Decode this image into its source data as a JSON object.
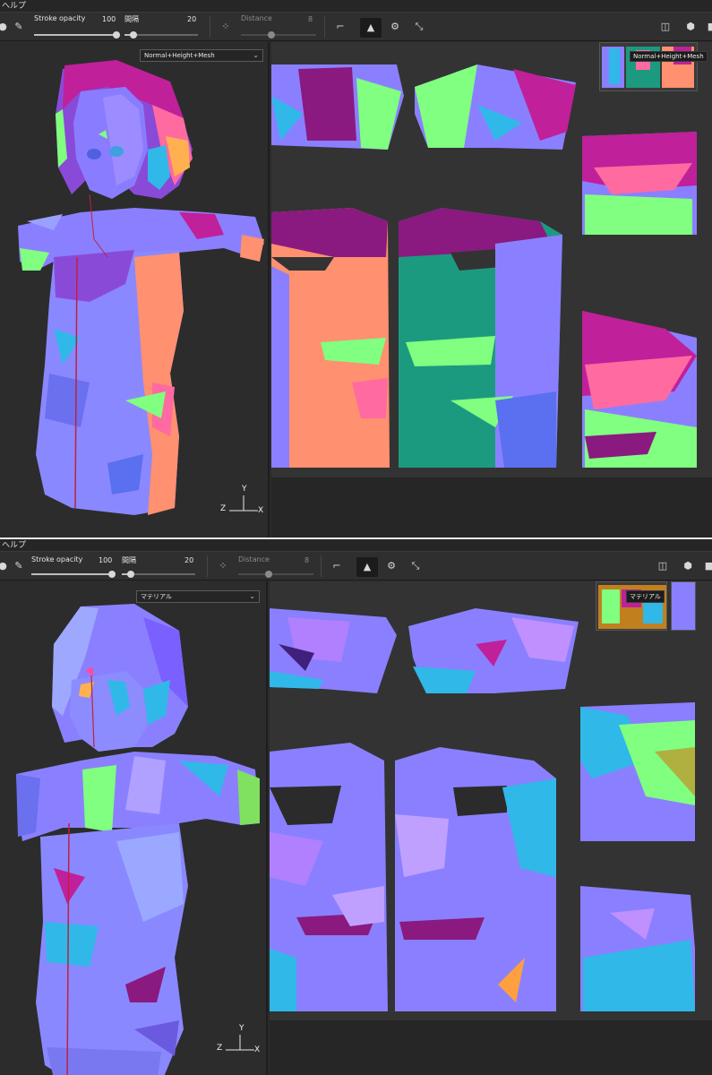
{
  "panels": [
    {
      "menu_label": "ヘルプ",
      "stroke_opacity_label": "Stroke opacity",
      "stroke_opacity_value": "100",
      "spacing_label": "間隔",
      "spacing_value": "20",
      "distance_label": "Distance",
      "distance_value": "8",
      "display_mode": "Normal+Height+Mesh",
      "tooltip": "Normal+Height+Mesh",
      "axis_z": "Z",
      "axis_y": "Y",
      "axis_x": "X"
    },
    {
      "menu_label": "ヘルプ",
      "stroke_opacity_label": "Stroke opacity",
      "stroke_opacity_value": "100",
      "spacing_label": "間隔",
      "spacing_value": "20",
      "distance_label": "Distance",
      "distance_value": "8",
      "display_mode": "マテリアル",
      "tooltip": "マテリアル",
      "axis_z": "Z",
      "axis_y": "Y",
      "axis_x": "X"
    }
  ],
  "sliders": {
    "stroke_opacity": 1.0,
    "spacing": 0.2
  },
  "colors": {
    "normal_blue": "#8080ff",
    "magenta": "#c0209a",
    "green": "#80ff80",
    "salmon": "#ff9070",
    "teal": "#1c9a80",
    "purple": "#8a4ad8",
    "pink": "#ff6aa0",
    "cyan": "#30b8e8"
  },
  "icons": [
    "brush-icon",
    "dot-icon",
    "spread-dots-icon",
    "curve-icon",
    "mirror-icon",
    "settings-icon",
    "transform-icon",
    "symmetry-icon",
    "cube-icon",
    "square-icon"
  ]
}
